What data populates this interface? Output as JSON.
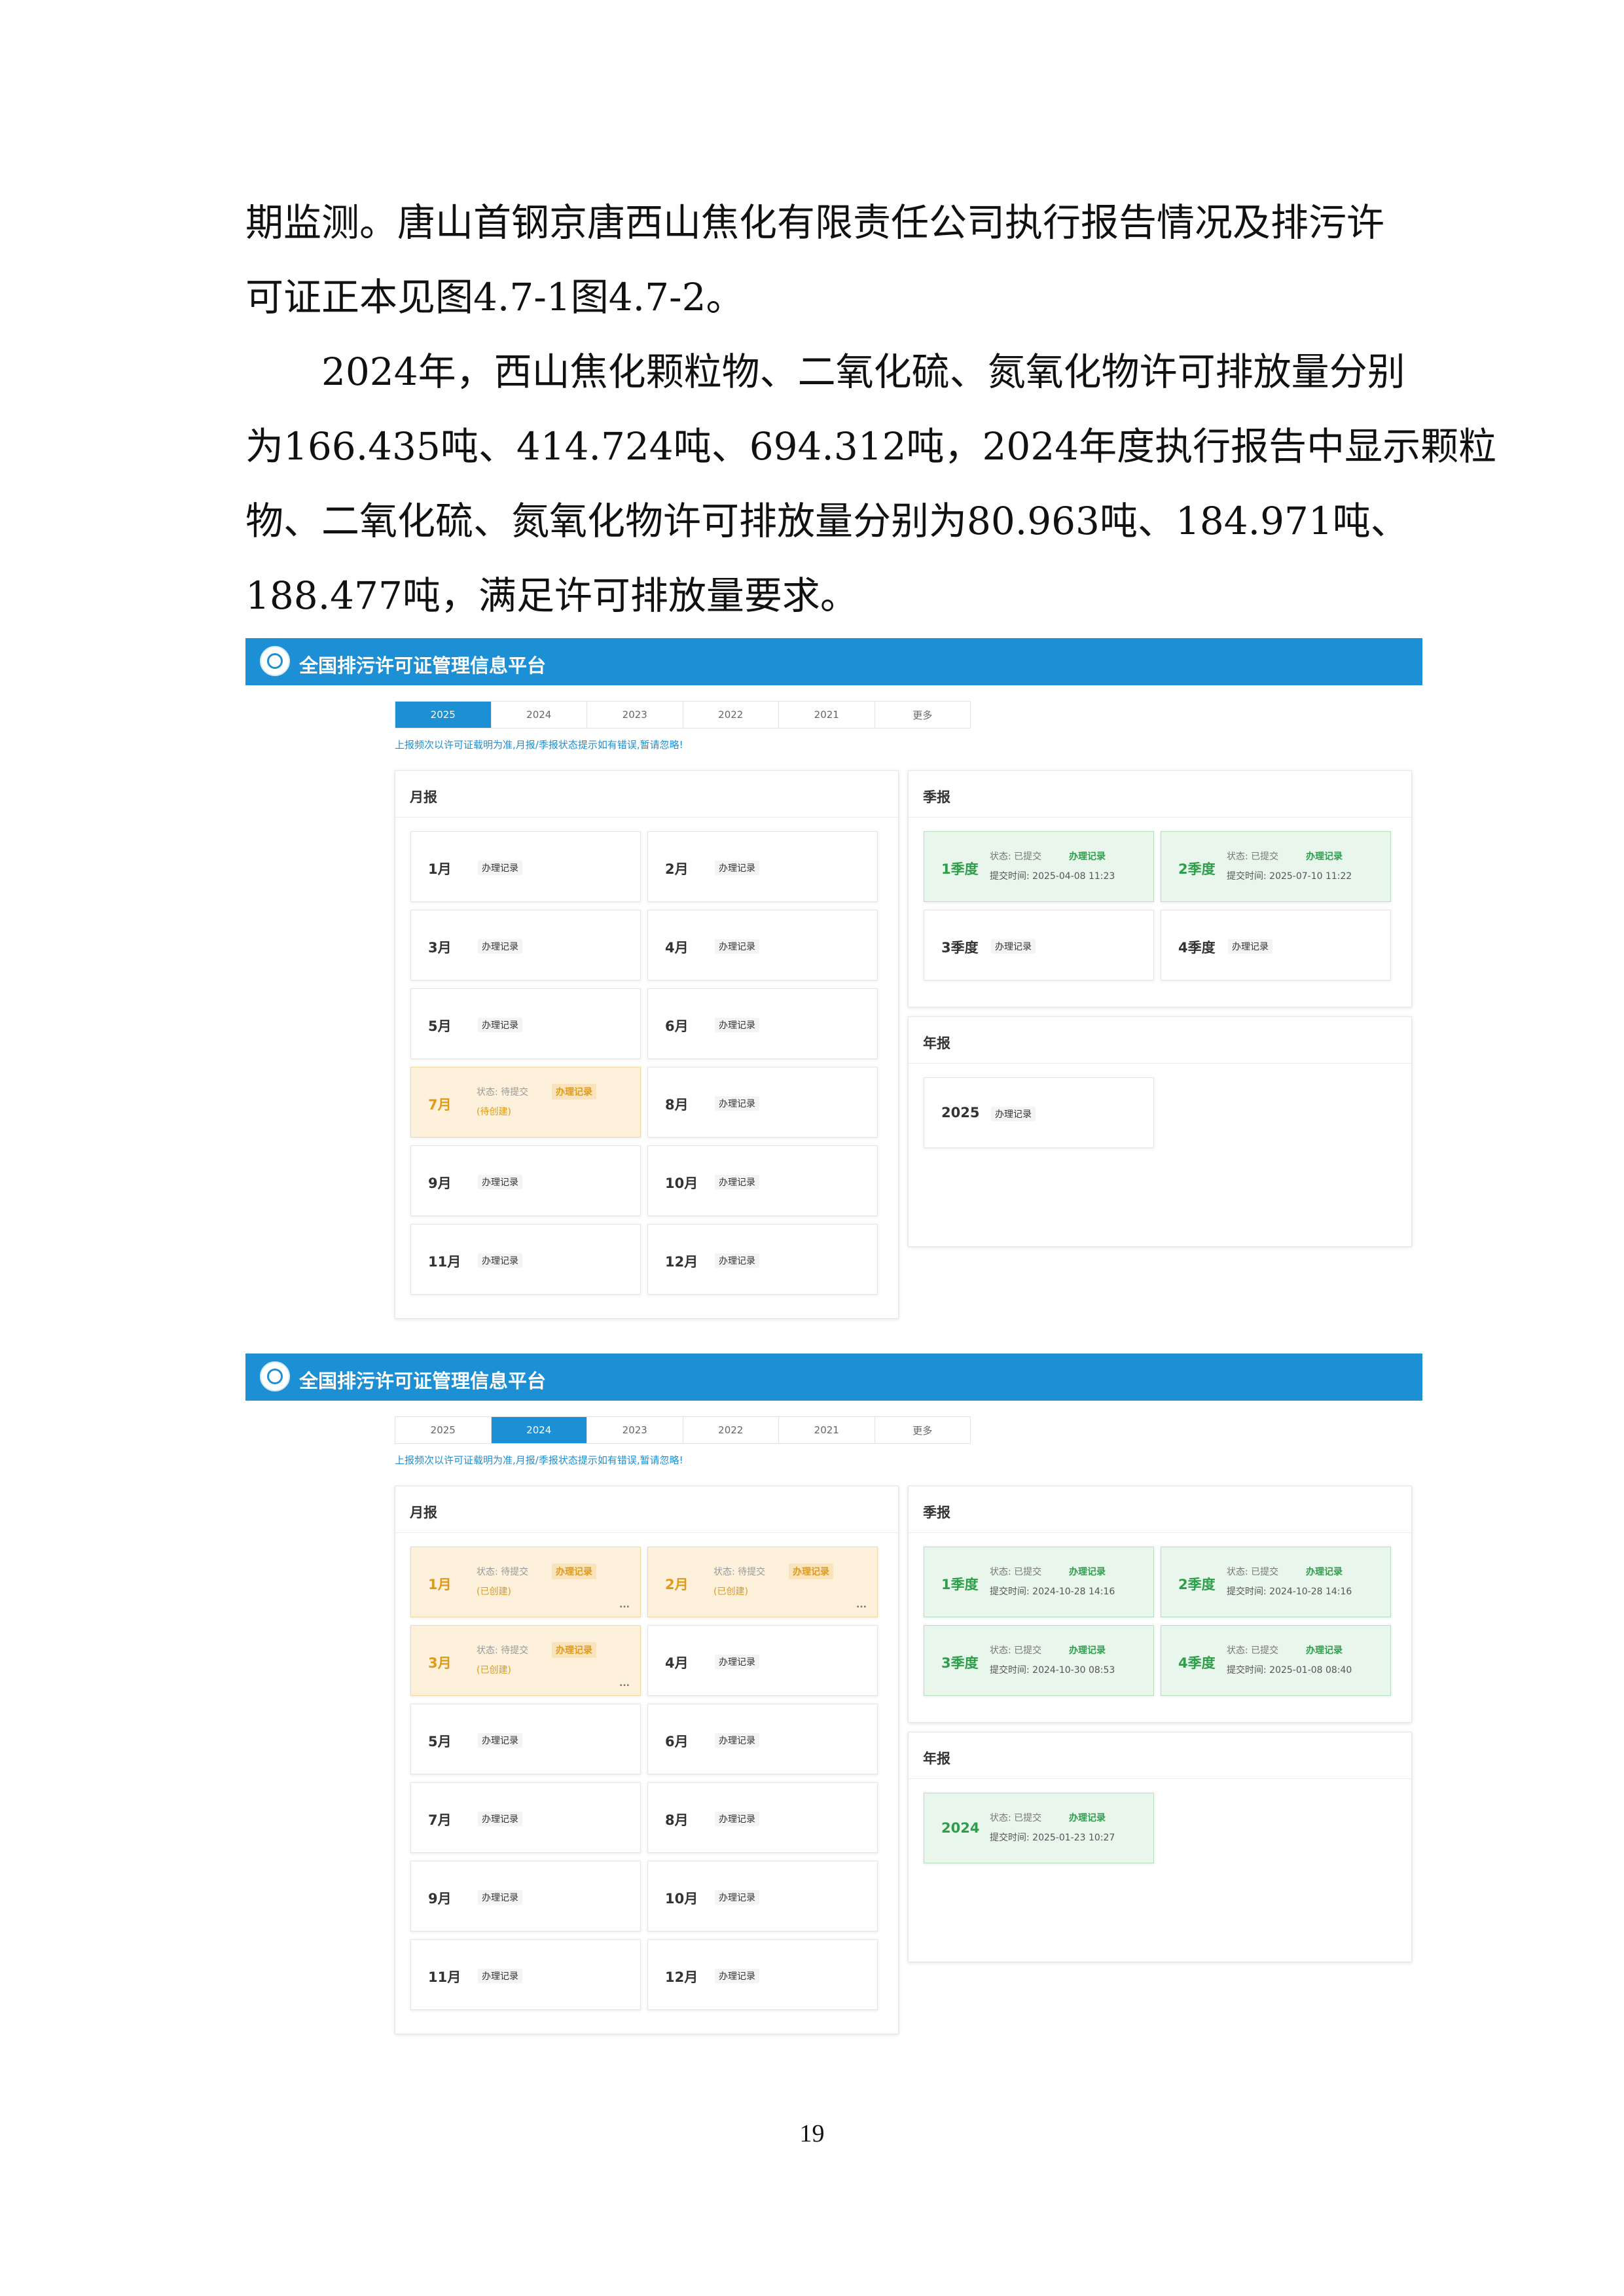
{
  "text": {
    "lines": [
      "期监测。唐山首钢京唐西山焦化有限责任公司执行报告情况及排污许",
      "可证正本见图4.7-1图4.7-2。",
      "2024年，西山焦化颗粒物、二氧化硫、氮氧化物许可排放量分别",
      "为166.435吨、414.724吨、694.312吨，2024年度执行报告中显示颗粒",
      "物、二氧化硫、氮氧化物许可排放量分别为80.963吨、184.971吨、",
      "188.477吨，满足许可排放量要求。"
    ]
  },
  "page_number": "19",
  "platform": {
    "title": "全国排污许可证管理信息平台",
    "tabs": [
      "2025",
      "2024",
      "2023",
      "2022",
      "2021",
      "更多"
    ],
    "notice": "上报频次以许可证载明为准,月报/季报状态提示如有错误,暂请忽略!",
    "monthly_title": "月报",
    "quarterly_title": "季报",
    "annual_title": "年报",
    "record_label": "办理记录",
    "status_pending": "状态: 待提交",
    "status_submitted": "状态: 已提交",
    "created_label": "(待创建)",
    "created_done_label": "(已创建)",
    "dots": "...",
    "colors": {
      "header": "#1d8fd5",
      "pending_bg": "#fdf1dc",
      "done_bg": "#e9f6ec"
    }
  },
  "screens": [
    {
      "active_tab": "2025",
      "months": [
        {
          "label": "1月",
          "state": "plain"
        },
        {
          "label": "2月",
          "state": "plain"
        },
        {
          "label": "3月",
          "state": "plain"
        },
        {
          "label": "4月",
          "state": "plain"
        },
        {
          "label": "5月",
          "state": "plain"
        },
        {
          "label": "6月",
          "state": "plain"
        },
        {
          "label": "7月",
          "state": "pending",
          "sub": "(待创建)"
        },
        {
          "label": "8月",
          "state": "plain"
        },
        {
          "label": "9月",
          "state": "plain"
        },
        {
          "label": "10月",
          "state": "plain"
        },
        {
          "label": "11月",
          "state": "plain"
        },
        {
          "label": "12月",
          "state": "plain"
        }
      ],
      "quarters": [
        {
          "label": "1季度",
          "state": "done",
          "time": "提交时间: 2025-04-08 11:23"
        },
        {
          "label": "2季度",
          "state": "done",
          "time": "提交时间: 2025-07-10 11:22"
        },
        {
          "label": "3季度",
          "state": "plain"
        },
        {
          "label": "4季度",
          "state": "plain"
        }
      ],
      "annual": {
        "label": "2025",
        "state": "plain"
      }
    },
    {
      "active_tab": "2024",
      "months": [
        {
          "label": "1月",
          "state": "pending",
          "sub": "(已创建)"
        },
        {
          "label": "2月",
          "state": "pending",
          "sub": "(已创建)"
        },
        {
          "label": "3月",
          "state": "pending",
          "sub": "(已创建)"
        },
        {
          "label": "4月",
          "state": "plain"
        },
        {
          "label": "5月",
          "state": "plain"
        },
        {
          "label": "6月",
          "state": "plain"
        },
        {
          "label": "7月",
          "state": "plain"
        },
        {
          "label": "8月",
          "state": "plain"
        },
        {
          "label": "9月",
          "state": "plain"
        },
        {
          "label": "10月",
          "state": "plain"
        },
        {
          "label": "11月",
          "state": "plain"
        },
        {
          "label": "12月",
          "state": "plain"
        }
      ],
      "quarters": [
        {
          "label": "1季度",
          "state": "done",
          "time": "提交时间: 2024-10-28 14:16"
        },
        {
          "label": "2季度",
          "state": "done",
          "time": "提交时间: 2024-10-28 14:16"
        },
        {
          "label": "3季度",
          "state": "done",
          "time": "提交时间: 2024-10-30 08:53"
        },
        {
          "label": "4季度",
          "state": "done",
          "time": "提交时间: 2025-01-08 08:40"
        }
      ],
      "annual": {
        "label": "2024",
        "state": "done",
        "time": "提交时间: 2025-01-23 10:27"
      }
    }
  ]
}
